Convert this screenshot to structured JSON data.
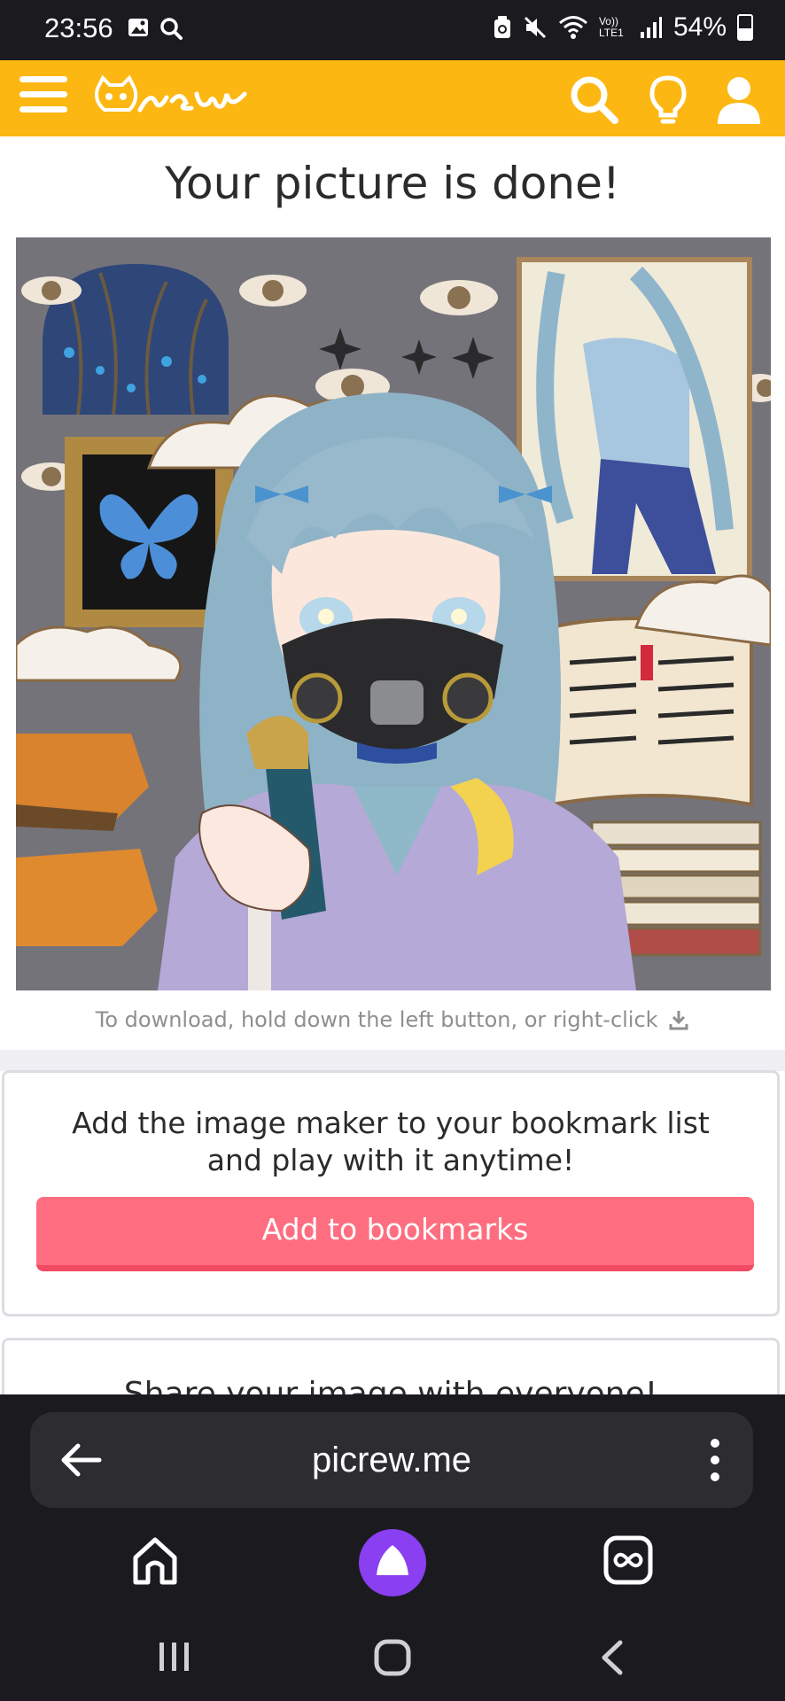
{
  "status_bar": {
    "time": "23:56",
    "battery": "54%",
    "left_icons": [
      "gallery-icon",
      "search-icon"
    ],
    "right_icons": [
      "recycle-icon",
      "mute-icon",
      "wifi-icon",
      "volte-icon",
      "signal-icon",
      "battery-icon"
    ],
    "volte_label": "Vo)) LTE1"
  },
  "header": {
    "logo_text": "Picrew",
    "icons": [
      "menu-icon",
      "search-icon",
      "lightbulb-icon",
      "user-icon"
    ],
    "background": "#fcb712"
  },
  "main": {
    "title": "Your picture is done!",
    "download_hint": "To download, hold down the left button, or right-click",
    "bookmark_card": {
      "text_line1": "Add the image maker to your bookmark list",
      "text_line2": "and play with it anytime!",
      "button_label": "Add to bookmarks",
      "button_color": "#fe6e80"
    },
    "share_card": {
      "text": "Share your image with everyone!"
    }
  },
  "browser": {
    "url": "picrew.me",
    "nav_icons": [
      "home-icon",
      "assistant-icon",
      "tabs-icon"
    ],
    "system_nav": [
      "recent-apps-icon",
      "home-button-icon",
      "back-icon"
    ]
  }
}
